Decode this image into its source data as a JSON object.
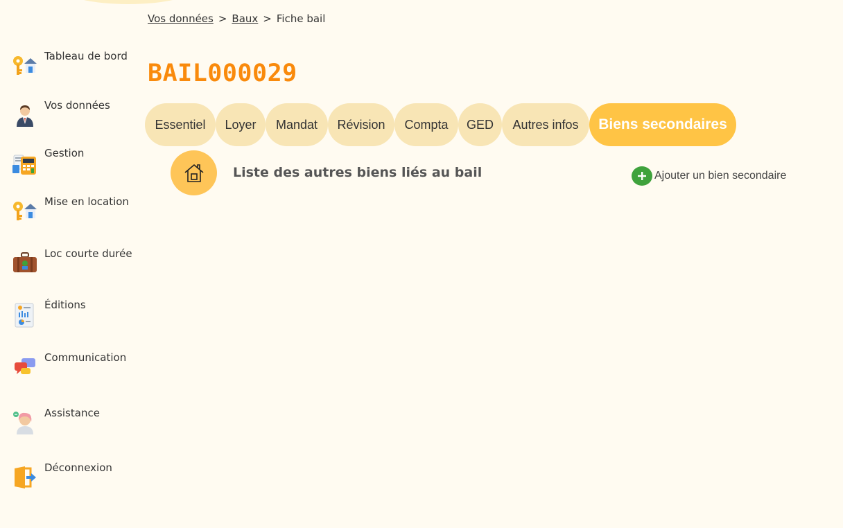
{
  "breadcrumb": {
    "item1": "Vos données",
    "sep1": ">",
    "item2": "Baux",
    "sep2": ">",
    "current": "Fiche bail"
  },
  "page": {
    "title": "BAIL000029"
  },
  "sidebar": {
    "items": [
      {
        "label": "Tableau de bord",
        "icon": "keys-house-icon"
      },
      {
        "label": "Vos données",
        "icon": "person-avatar-icon"
      },
      {
        "label": "Gestion",
        "icon": "calculator-icon"
      },
      {
        "label": "Mise en location",
        "icon": "keys-house-icon"
      },
      {
        "label": "Loc courte durée",
        "icon": "suitcase-icon"
      },
      {
        "label": "Éditions",
        "icon": "report-icon"
      },
      {
        "label": "Communication",
        "icon": "chat-bubbles-icon"
      },
      {
        "label": "Assistance",
        "icon": "support-agent-icon"
      },
      {
        "label": "Déconnexion",
        "icon": "logout-icon"
      }
    ]
  },
  "tabs": [
    {
      "label": "Essentiel",
      "active": false
    },
    {
      "label": "Loyer",
      "active": false
    },
    {
      "label": "Mandat",
      "active": false
    },
    {
      "label": "Révision",
      "active": false
    },
    {
      "label": "Compta",
      "active": false
    },
    {
      "label": "GED",
      "active": false
    },
    {
      "label": "Autres infos",
      "active": false
    },
    {
      "label": "Biens secondaires",
      "active": true
    }
  ],
  "section": {
    "title": "Liste des autres biens liés au bail",
    "icon": "house-icon",
    "add_label": "Ajouter un bien secondaire",
    "add_icon": "plus-circle-icon"
  },
  "colors": {
    "background": "#fffbf1",
    "title": "#f98a0c",
    "tab": "#f8e5b5",
    "tab_active": "#ffc445",
    "icon_circle": "#fec558",
    "add_green": "#3fa23c"
  }
}
